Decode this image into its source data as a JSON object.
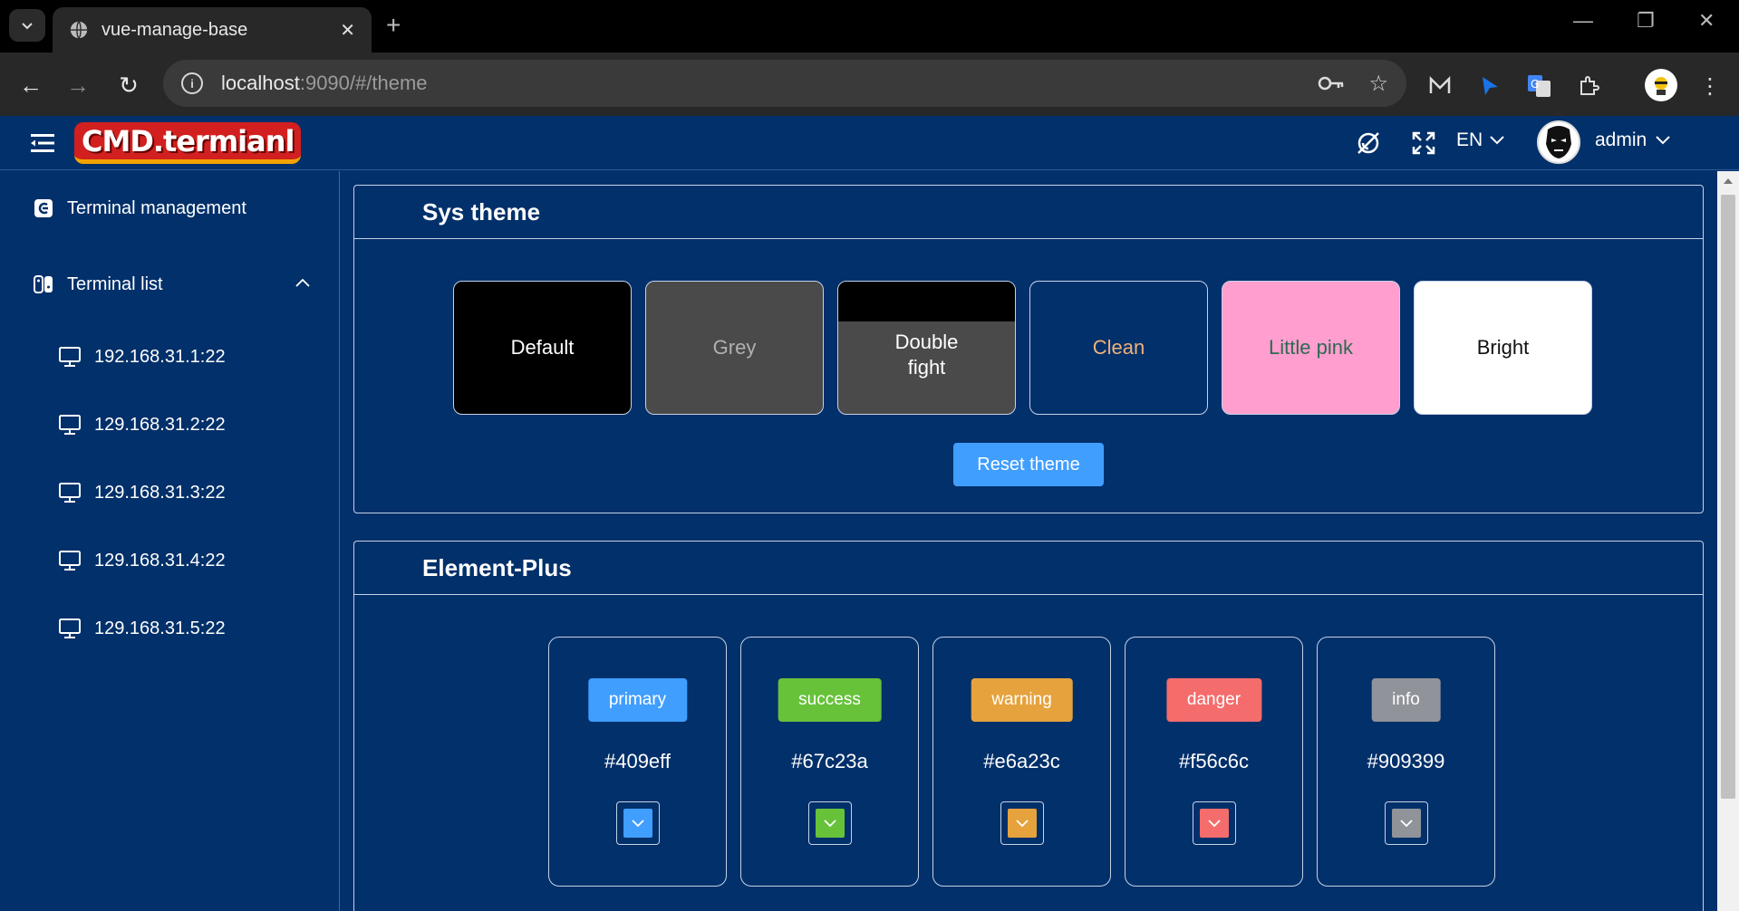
{
  "browser": {
    "tab_title": "vue-manage-base",
    "url_host": "localhost",
    "url_rest": ":9090/#/theme"
  },
  "header": {
    "logo_text": "CMD.termianl",
    "language": "EN",
    "username": "admin"
  },
  "sidebar": {
    "items": [
      {
        "label": "Terminal management",
        "icon": "terminal-management-icon"
      },
      {
        "label": "Terminal list",
        "icon": "terminal-list-icon",
        "expanded": true
      }
    ],
    "sub_items": [
      {
        "label": "192.168.31.1:22"
      },
      {
        "label": "129.168.31.2:22"
      },
      {
        "label": "129.168.31.3:22"
      },
      {
        "label": "129.168.31.4:22"
      },
      {
        "label": "129.168.31.5:22"
      }
    ]
  },
  "sys_theme": {
    "title": "Sys theme",
    "themes": [
      {
        "label": "Default",
        "bg": "#000000",
        "fg": "#ffffff"
      },
      {
        "label": "Grey",
        "bg": "#4a4a4a",
        "fg": "#b0b0b0"
      },
      {
        "label": "Double fight",
        "bg": "#4a4a4a",
        "fg": "#ffffff",
        "top": "#000000"
      },
      {
        "label": "Clean",
        "bg": "#02306a",
        "fg": "#f0b27a"
      },
      {
        "label": "Little pink",
        "bg": "#ff9ecf",
        "fg": "#2d6a4f"
      },
      {
        "label": "Bright",
        "bg": "#ffffff",
        "fg": "#111111"
      }
    ],
    "reset_label": "Reset theme"
  },
  "element_plus": {
    "title": "Element-Plus",
    "colors": [
      {
        "tag": "primary",
        "hex": "#409eff"
      },
      {
        "tag": "success",
        "hex": "#67c23a"
      },
      {
        "tag": "warning",
        "hex": "#e6a23c"
      },
      {
        "tag": "danger",
        "hex": "#f56c6c"
      },
      {
        "tag": "info",
        "hex": "#909399"
      }
    ]
  }
}
